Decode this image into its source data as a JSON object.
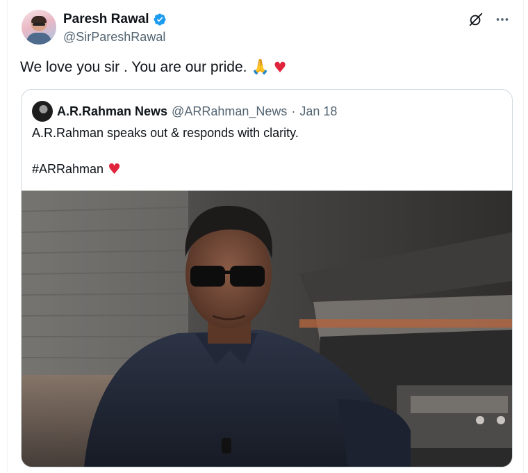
{
  "post": {
    "author_name": "Paresh Rawal",
    "author_handle": "@SirPareshRawal",
    "text": "We love you sir . You are our pride.",
    "emoji_1": "🙏",
    "emoji_2": "♥"
  },
  "icons": {
    "grok": "grok-icon",
    "more": "more-icon",
    "verified": "verified-badge-icon"
  },
  "quoted": {
    "author_name": "A.R.Rahman News",
    "author_handle": "@ARRahman_News",
    "separator": "·",
    "date": "Jan 18",
    "text": "A.R.Rahman speaks out & responds with clarity.",
    "hashtag": "#ARRahman",
    "hashtag_emoji": "♥"
  },
  "colors": {
    "verified": "#1d9bf0",
    "heart": "#e0243c",
    "secondary_text": "#536471"
  }
}
